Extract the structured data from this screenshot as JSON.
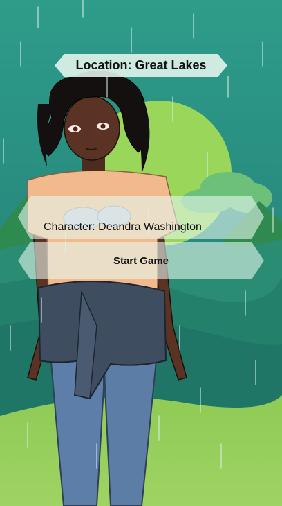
{
  "location": {
    "label": "Location: Great Lakes"
  },
  "character": {
    "label": "Character: Deandra Washington"
  },
  "start_button": {
    "label": "Start Game"
  },
  "colors": {
    "sky_top": "#2f9c8a",
    "sky_bottom": "#1f7d74",
    "sun": "#9bd85a",
    "hills_front": "#8cc653",
    "panel_fill": "#e6f6ee",
    "skin": "#5a3324",
    "hair": "#141010",
    "shirt": "#f2b98c",
    "jacket": "#3f4d61",
    "jeans": "#5c7ea8"
  }
}
